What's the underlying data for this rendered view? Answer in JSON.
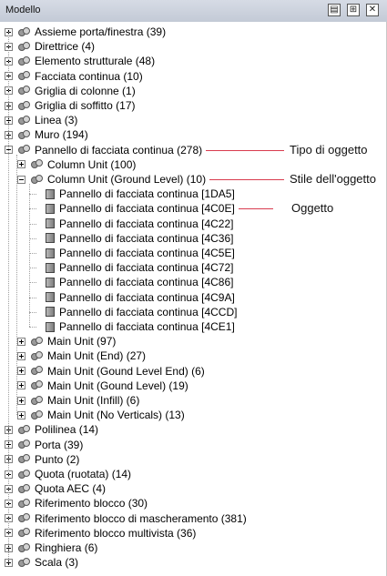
{
  "panel": {
    "title": "Modello",
    "buttons": [
      {
        "name": "properties-button",
        "glyph": "▤"
      },
      {
        "name": "toggle-view-button",
        "glyph": "⊞"
      },
      {
        "name": "close-button",
        "glyph": "✕"
      }
    ]
  },
  "tree": [
    {
      "label": "Assieme porta/finestra (39)",
      "level": 0,
      "expander": "plus",
      "icon": "category"
    },
    {
      "label": "Direttrice (4)",
      "level": 0,
      "expander": "plus",
      "icon": "category"
    },
    {
      "label": "Elemento strutturale (48)",
      "level": 0,
      "expander": "plus",
      "icon": "category"
    },
    {
      "label": "Facciata continua (10)",
      "level": 0,
      "expander": "plus",
      "icon": "category"
    },
    {
      "label": "Griglia di colonne (1)",
      "level": 0,
      "expander": "plus",
      "icon": "category"
    },
    {
      "label": "Griglia di soffitto (17)",
      "level": 0,
      "expander": "plus",
      "icon": "category"
    },
    {
      "label": "Linea (3)",
      "level": 0,
      "expander": "plus",
      "icon": "category"
    },
    {
      "label": "Muro (194)",
      "level": 0,
      "expander": "plus",
      "icon": "category"
    },
    {
      "label": "Pannello di facciata continua (278)",
      "level": 0,
      "expander": "minus",
      "icon": "category"
    },
    {
      "label": "Column Unit (100)",
      "level": 1,
      "expander": "plus",
      "icon": "category"
    },
    {
      "label": "Column Unit (Ground Level) (10)",
      "level": 1,
      "expander": "minus",
      "icon": "category"
    },
    {
      "label": "Pannello di facciata continua [1DA5]",
      "level": 2,
      "expander": "none",
      "icon": "object"
    },
    {
      "label": "Pannello di facciata continua [4C0E]",
      "level": 2,
      "expander": "none",
      "icon": "object"
    },
    {
      "label": "Pannello di facciata continua [4C22]",
      "level": 2,
      "expander": "none",
      "icon": "object"
    },
    {
      "label": "Pannello di facciata continua [4C36]",
      "level": 2,
      "expander": "none",
      "icon": "object"
    },
    {
      "label": "Pannello di facciata continua [4C5E]",
      "level": 2,
      "expander": "none",
      "icon": "object"
    },
    {
      "label": "Pannello di facciata continua [4C72]",
      "level": 2,
      "expander": "none",
      "icon": "object"
    },
    {
      "label": "Pannello di facciata continua [4C86]",
      "level": 2,
      "expander": "none",
      "icon": "object"
    },
    {
      "label": "Pannello di facciata continua [4C9A]",
      "level": 2,
      "expander": "none",
      "icon": "object"
    },
    {
      "label": "Pannello di facciata continua [4CCD]",
      "level": 2,
      "expander": "none",
      "icon": "object"
    },
    {
      "label": "Pannello di facciata continua [4CE1]",
      "level": 2,
      "expander": "none",
      "icon": "object"
    },
    {
      "label": "Main Unit (97)",
      "level": 1,
      "expander": "plus",
      "icon": "category"
    },
    {
      "label": "Main Unit (End) (27)",
      "level": 1,
      "expander": "plus",
      "icon": "category"
    },
    {
      "label": "Main Unit (Gound Level End) (6)",
      "level": 1,
      "expander": "plus",
      "icon": "category"
    },
    {
      "label": "Main Unit (Gound Level) (19)",
      "level": 1,
      "expander": "plus",
      "icon": "category"
    },
    {
      "label": "Main Unit (Infill) (6)",
      "level": 1,
      "expander": "plus",
      "icon": "category"
    },
    {
      "label": "Main Unit (No Verticals) (13)",
      "level": 1,
      "expander": "plus",
      "icon": "category"
    },
    {
      "label": "Polilinea (14)",
      "level": 0,
      "expander": "plus",
      "icon": "category"
    },
    {
      "label": "Porta (39)",
      "level": 0,
      "expander": "plus",
      "icon": "category"
    },
    {
      "label": "Punto (2)",
      "level": 0,
      "expander": "plus",
      "icon": "category"
    },
    {
      "label": "Quota (ruotata) (14)",
      "level": 0,
      "expander": "plus",
      "icon": "category"
    },
    {
      "label": "Quota AEC (4)",
      "level": 0,
      "expander": "plus",
      "icon": "category"
    },
    {
      "label": "Riferimento blocco (30)",
      "level": 0,
      "expander": "plus",
      "icon": "category"
    },
    {
      "label": "Riferimento blocco di mascheramento (381)",
      "level": 0,
      "expander": "plus",
      "icon": "category"
    },
    {
      "label": "Riferimento blocco multivista (36)",
      "level": 0,
      "expander": "plus",
      "icon": "category"
    },
    {
      "label": "Ringhiera (6)",
      "level": 0,
      "expander": "plus",
      "icon": "category"
    },
    {
      "label": "Scala (3)",
      "level": 0,
      "expander": "plus",
      "icon": "category"
    }
  ],
  "annotations": [
    {
      "label": "Tipo di oggetto",
      "row": 8
    },
    {
      "label": "Stile dell'oggetto",
      "row": 10
    },
    {
      "label": "Oggetto",
      "row": 12
    }
  ],
  "colors": {
    "callout_line": "#d93c4f"
  }
}
